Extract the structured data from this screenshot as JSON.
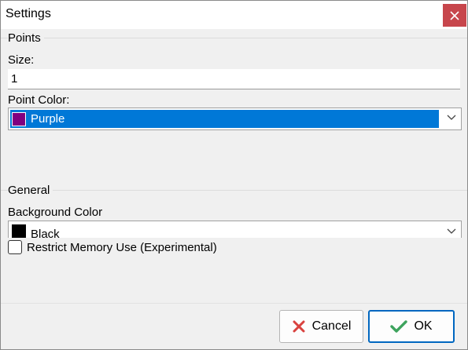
{
  "window": {
    "title": "Settings",
    "close_icon": "close-icon",
    "close_color": "#c7464c"
  },
  "points": {
    "group_label": "Points",
    "size_label": "Size:",
    "size_value": "1",
    "color_label": "Point Color:",
    "color_value": "Purple",
    "color_swatch": "#800080",
    "selection_color": "#0078d7"
  },
  "general": {
    "group_label": "General",
    "bg_label": "Background Color",
    "bg_value": "Black",
    "bg_swatch": "#000000",
    "restrict_label": "Restrict Memory Use (Experimental)",
    "restrict_checked": false
  },
  "buttons": {
    "cancel_label": "Cancel",
    "cancel_icon": "x-icon",
    "ok_label": "OK",
    "ok_icon": "checkmark-icon"
  }
}
